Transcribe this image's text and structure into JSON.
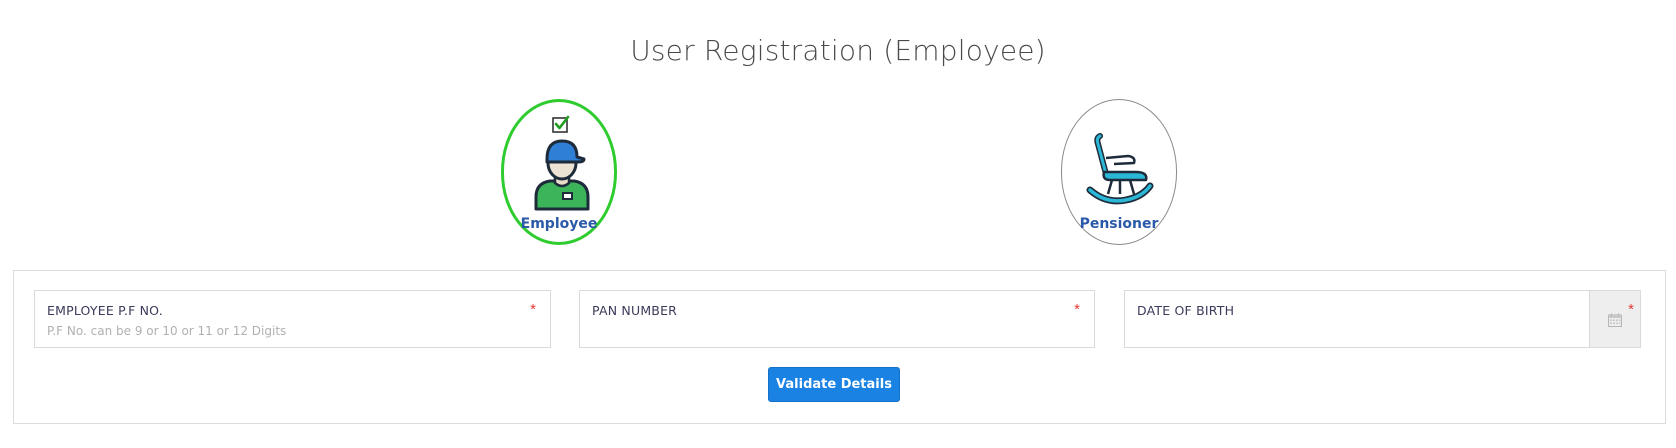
{
  "page": {
    "title": "User Registration (Employee)"
  },
  "user_types": [
    {
      "label": "Employee",
      "selected": true,
      "icon": "employee-avatar-icon"
    },
    {
      "label": "Pensioner",
      "selected": false,
      "icon": "rocking-chair-icon"
    }
  ],
  "form": {
    "fields": [
      {
        "label": "EMPLOYEE P.F NO.",
        "placeholder": "P.F No. can be 9 or 10 or 11 or 12 Digits",
        "value": "",
        "required": true
      },
      {
        "label": "PAN NUMBER",
        "placeholder": "",
        "value": "",
        "required": true
      },
      {
        "label": "DATE OF BIRTH",
        "placeholder": "",
        "value": "",
        "required": true,
        "icon": "calendar-icon"
      }
    ],
    "required_marker": "*",
    "submit_label": "Validate Details"
  },
  "colors": {
    "selected_border": "#2ecc2e",
    "unselected_border": "#8a8a8a",
    "card_label": "#2a5aa8",
    "primary_button": "#1a82e2",
    "required": "#e53935"
  }
}
